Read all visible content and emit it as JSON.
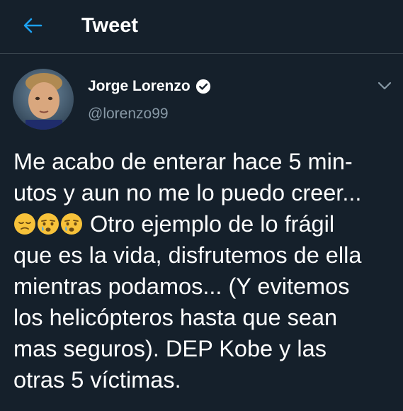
{
  "header": {
    "back_icon": "arrow-left-icon",
    "title": "Tweet"
  },
  "colors": {
    "background": "#15202b",
    "accent": "#1da1f2",
    "muted_text": "#8899a6",
    "divider": "#38444d"
  },
  "tweet": {
    "author_name": "Jorge Lorenzo",
    "verified_icon": "verified-badge-icon",
    "handle": "@lorenzo99",
    "menu_icon": "chevron-down-icon",
    "lines": [
      "Me acabo de enterar hace 5 min-",
      "utos y aun no me lo puedo creer...",
      " Otro ejemplo de lo frágil",
      "que es la vida, disfrutemos de ella",
      "mientras podamos... (Y evitemos",
      "los helicópteros hasta que sean",
      "mas seguros). DEP Kobe y las",
      "otras 5 víctimas."
    ],
    "emojis": [
      "pensive-face-emoji",
      "crying-face-emoji",
      "crying-face-emoji"
    ]
  }
}
